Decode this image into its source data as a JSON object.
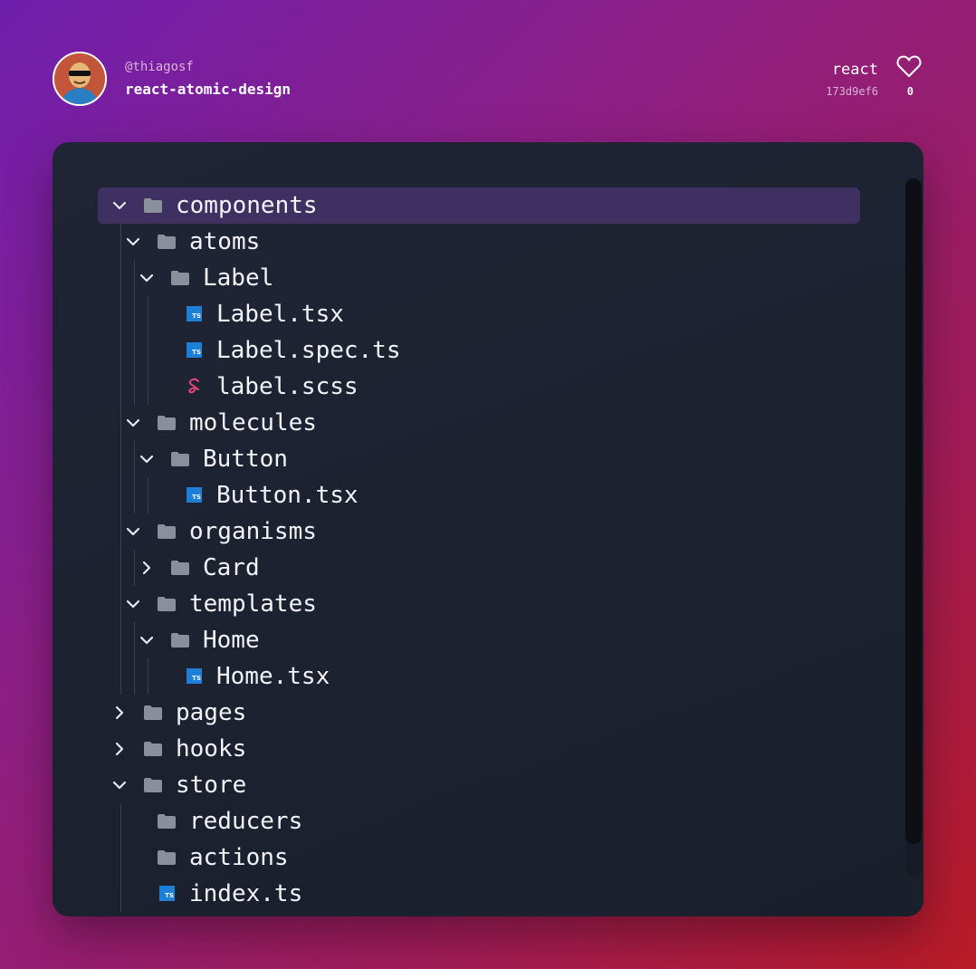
{
  "header": {
    "author": "@thiagosf",
    "repo": "react-atomic-design",
    "language": "react",
    "commit": "173d9ef6",
    "likes": "0",
    "like_icon": "heart-icon",
    "avatar_icon": "avatar"
  },
  "colors": {
    "accent_selected": "#3e3060",
    "panel_bg": "#1d2230",
    "folder_icon": "#8a8f9c",
    "ts_icon": "#1d7fd6",
    "sass_icon": "#e0457b"
  },
  "tree": [
    {
      "name": "components",
      "kind": "folder",
      "expanded": true,
      "selected": true
    },
    {
      "name": "atoms",
      "kind": "folder",
      "expanded": true
    },
    {
      "name": "Label",
      "kind": "folder",
      "expanded": true
    },
    {
      "name": "Label.tsx",
      "kind": "ts"
    },
    {
      "name": "Label.spec.ts",
      "kind": "ts"
    },
    {
      "name": "label.scss",
      "kind": "sass"
    },
    {
      "name": "molecules",
      "kind": "folder",
      "expanded": true
    },
    {
      "name": "Button",
      "kind": "folder",
      "expanded": true
    },
    {
      "name": "Button.tsx",
      "kind": "ts"
    },
    {
      "name": "organisms",
      "kind": "folder",
      "expanded": true
    },
    {
      "name": "Card",
      "kind": "folder",
      "expanded": false
    },
    {
      "name": "templates",
      "kind": "folder",
      "expanded": true
    },
    {
      "name": "Home",
      "kind": "folder",
      "expanded": true
    },
    {
      "name": "Home.tsx",
      "kind": "ts"
    },
    {
      "name": "pages",
      "kind": "folder",
      "expanded": false
    },
    {
      "name": "hooks",
      "kind": "folder",
      "expanded": false
    },
    {
      "name": "store",
      "kind": "folder",
      "expanded": true
    },
    {
      "name": "reducers",
      "kind": "folder"
    },
    {
      "name": "actions",
      "kind": "folder"
    },
    {
      "name": "index.ts",
      "kind": "ts"
    }
  ]
}
